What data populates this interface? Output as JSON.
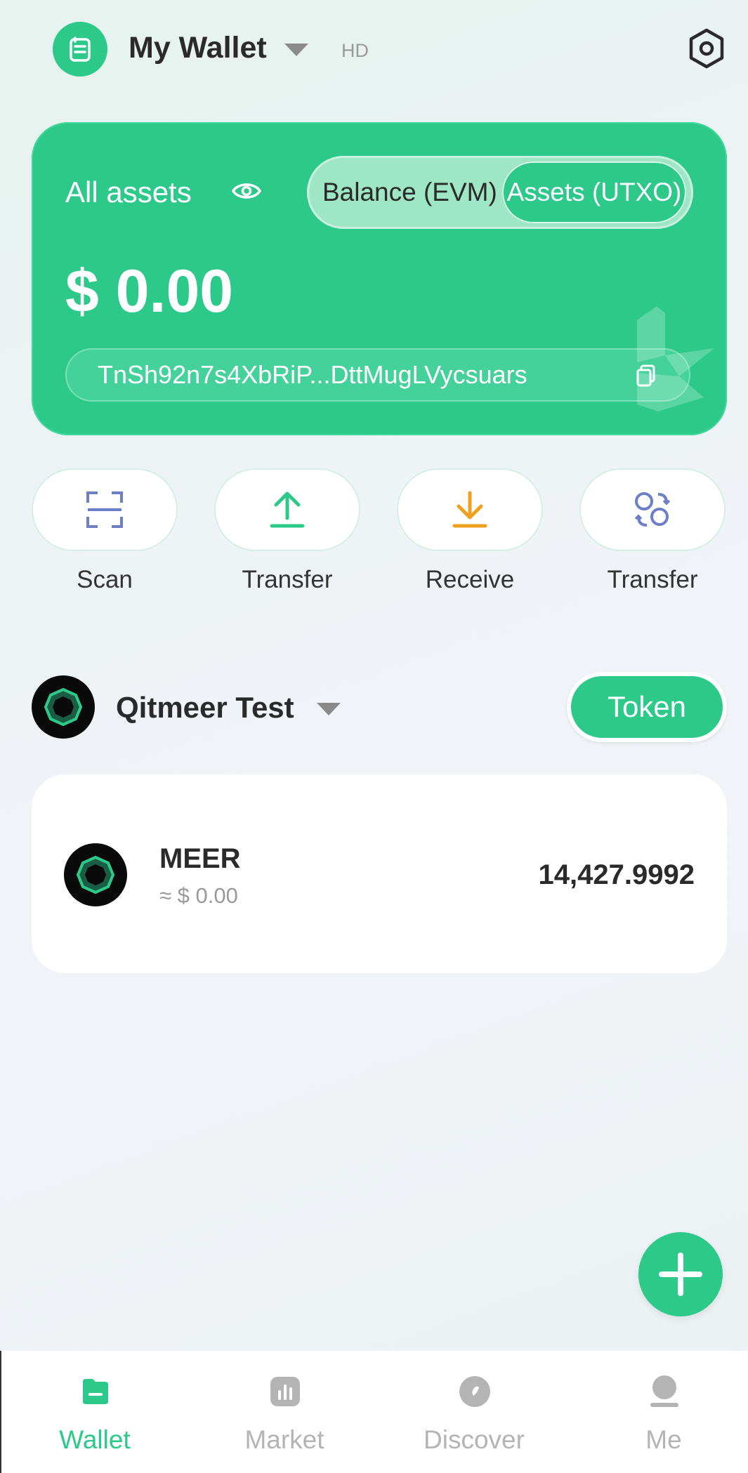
{
  "header": {
    "wallet_name": "My Wallet",
    "hd_badge": "HD",
    "icons": {
      "logo": "wallet-logo-icon",
      "caret": "chevron-down-icon",
      "settings": "hexagon-settings-icon"
    }
  },
  "asset_card": {
    "title": "All assets",
    "segments": [
      "Balance (EVM)",
      "Assets (UTXO)"
    ],
    "selected_segment": "Assets (UTXO)",
    "balance": "$ 0.00",
    "address": "TnSh92n7s4XbRiP...DttMugLVycsuars",
    "icons": {
      "eye": "eye-icon",
      "copy": "copy-icon"
    }
  },
  "actions": [
    {
      "label": "Scan",
      "icon": "scan-icon",
      "color": "#6d7fc7"
    },
    {
      "label": "Transfer",
      "icon": "upload-arrow-icon",
      "color": "#2dc98a"
    },
    {
      "label": "Receive",
      "icon": "download-arrow-icon",
      "color": "#f0a020"
    },
    {
      "label": "Transfer",
      "icon": "swap-circles-icon",
      "color": "#6d7fc7"
    }
  ],
  "network": {
    "name": "Qitmeer Test",
    "token_button": "Token",
    "icon": "qitmeer-logo-icon"
  },
  "tokens": [
    {
      "symbol": "MEER",
      "fiat": "≈ $ 0.00",
      "amount": "14,427.9992",
      "icon": "meer-logo-icon"
    }
  ],
  "fab_icon": "plus-icon",
  "nav": {
    "items": [
      {
        "label": "Wallet",
        "icon": "wallet-icon",
        "active": true
      },
      {
        "label": "Market",
        "icon": "bar-chart-icon",
        "active": false
      },
      {
        "label": "Discover",
        "icon": "compass-icon",
        "active": false
      },
      {
        "label": "Me",
        "icon": "user-icon",
        "active": false
      }
    ]
  },
  "colors": {
    "accent": "#2dc98a",
    "accent_light": "#9ee6c5",
    "text": "#2a2a2a",
    "muted": "#9a9a9a"
  }
}
